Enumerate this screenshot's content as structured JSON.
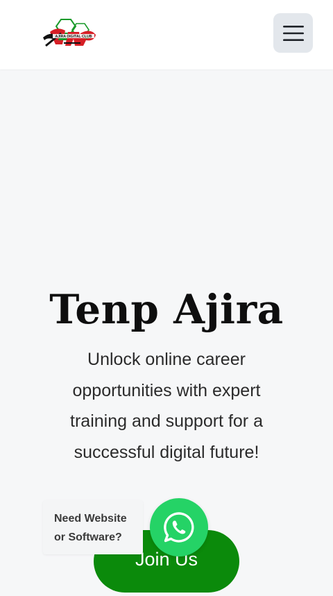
{
  "header": {
    "logo": {
      "icon": "ajira-digital-club-logo",
      "caption": "AJIRA DIGITAL CLUB"
    },
    "menu_button": {
      "icon": "hamburger-menu-icon",
      "aria_label": "Menu"
    }
  },
  "hero": {
    "title": "Tenp Ajira",
    "subtitle": "Unlock online career opportunities with expert training and support for a successful digital future!",
    "cta_label": "Join Us"
  },
  "whatsapp": {
    "bubble_line1": "Need Website",
    "bubble_line2": "or Software?",
    "icon": "whatsapp-icon"
  },
  "colors": {
    "background": "#f6f7f8",
    "header_bg": "#ffffff",
    "menu_button_bg": "#e3e7ec",
    "cta_green": "#0b8a0b",
    "whatsapp_green": "#25d366",
    "title_text": "#0e0e0e",
    "body_text": "#2b2b2b"
  }
}
